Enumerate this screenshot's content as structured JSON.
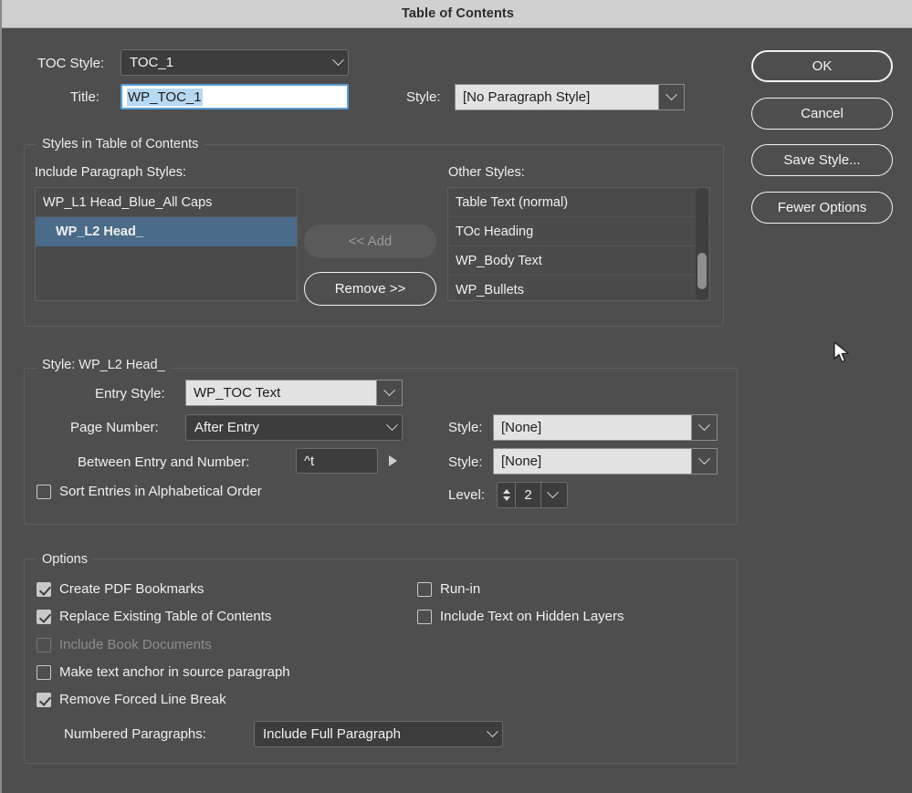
{
  "window": {
    "title": "Table of Contents"
  },
  "top": {
    "toc_style_label": "TOC Style:",
    "toc_style_value": "TOC_1",
    "title_label": "Title:",
    "title_value": "WP_TOC_1",
    "title_style_label": "Style:",
    "title_style_value": "[No Paragraph Style]"
  },
  "buttons": {
    "ok": "OK",
    "cancel": "Cancel",
    "save_style": "Save Style...",
    "fewer_options": "Fewer Options"
  },
  "styles_group": {
    "legend": "Styles in Table of Contents",
    "include_label": "Include Paragraph Styles:",
    "other_label": "Other Styles:",
    "include_items": [
      {
        "label": "WP_L1 Head_Blue_All Caps",
        "selected": false
      },
      {
        "label": "WP_L2 Head_",
        "selected": true
      }
    ],
    "other_items": [
      "Table Text (normal)",
      "TOc Heading",
      "WP_Body Text",
      "WP_Bullets"
    ],
    "add_button": "<< Add",
    "remove_button": "Remove >>"
  },
  "style_group": {
    "legend": "Style: WP_L2 Head_",
    "entry_style_label": "Entry Style:",
    "entry_style_value": "WP_TOC Text",
    "page_number_label": "Page Number:",
    "page_number_value": "After Entry",
    "page_number_style_label": "Style:",
    "page_number_style_value": "[None]",
    "between_label": "Between Entry and Number:",
    "between_value": "^t",
    "between_style_label": "Style:",
    "between_style_value": "[None]",
    "sort_label": "Sort Entries in Alphabetical Order",
    "sort_checked": false,
    "level_label": "Level:",
    "level_value": "2"
  },
  "options_group": {
    "legend": "Options",
    "left_items": [
      {
        "label": "Create PDF Bookmarks",
        "checked": true,
        "disabled": false
      },
      {
        "label": "Replace Existing Table of Contents",
        "checked": true,
        "disabled": false
      },
      {
        "label": "Include Book Documents",
        "checked": false,
        "disabled": true
      },
      {
        "label": "Make text anchor in source paragraph",
        "checked": false,
        "disabled": false
      },
      {
        "label": "Remove Forced Line Break",
        "checked": true,
        "disabled": false
      }
    ],
    "right_items": [
      {
        "label": "Run-in",
        "checked": false,
        "disabled": false
      },
      {
        "label": "Include Text on Hidden Layers",
        "checked": false,
        "disabled": false
      }
    ],
    "numbered_label": "Numbered Paragraphs:",
    "numbered_value": "Include Full Paragraph"
  },
  "colors": {
    "dialog_bg": "#4e4e4e",
    "titlebar_bg": "#d0d0d0",
    "selection_blue": "#4a6b8a",
    "text_selection": "#b6d8f2",
    "focus_border": "#5a9fd4"
  }
}
